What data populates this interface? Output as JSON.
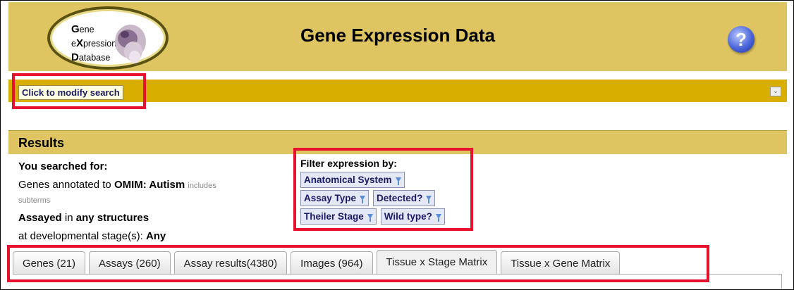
{
  "header": {
    "logo": {
      "line1_cap": "G",
      "line1_rest": "ene",
      "line2_pre": "e",
      "line2_cap": "X",
      "line2_rest": "pression",
      "line3_cap": "D",
      "line3_rest": "atabase"
    },
    "title": "Gene Expression Data",
    "help_label": "?"
  },
  "modify_bar": {
    "button_label": "Click to modify search",
    "collapse_icon": "chevron-down-icon"
  },
  "results": {
    "title": "Results",
    "you_searched_for": "You searched for:",
    "genes_prefix": "Genes annotated to ",
    "genes_term": "OMIM: Autism",
    "includes": "includes",
    "subterms": "subterms",
    "assayed": "Assayed",
    "in": " in ",
    "structures": "any structures",
    "stage_prefix": "at developmental stage(s): ",
    "stage_value": "Any"
  },
  "filters": {
    "label": "Filter expression by:",
    "rows": [
      [
        "Anatomical System"
      ],
      [
        "Assay Type",
        "Detected?"
      ],
      [
        "Theiler Stage",
        "Wild type?"
      ]
    ]
  },
  "tabs": [
    {
      "label": "Genes (21)",
      "active": false
    },
    {
      "label": "Assays (260)",
      "active": false
    },
    {
      "label": "Assay results(4380)",
      "active": false
    },
    {
      "label": "Images (964)",
      "active": false
    },
    {
      "label": "Tissue x Stage Matrix",
      "active": true
    },
    {
      "label": "Tissue x Gene Matrix",
      "active": false
    }
  ],
  "colors": {
    "highlight": "#e8112d",
    "header_bg": "#dfc562",
    "modify_bar_bg": "#d8ae00"
  }
}
